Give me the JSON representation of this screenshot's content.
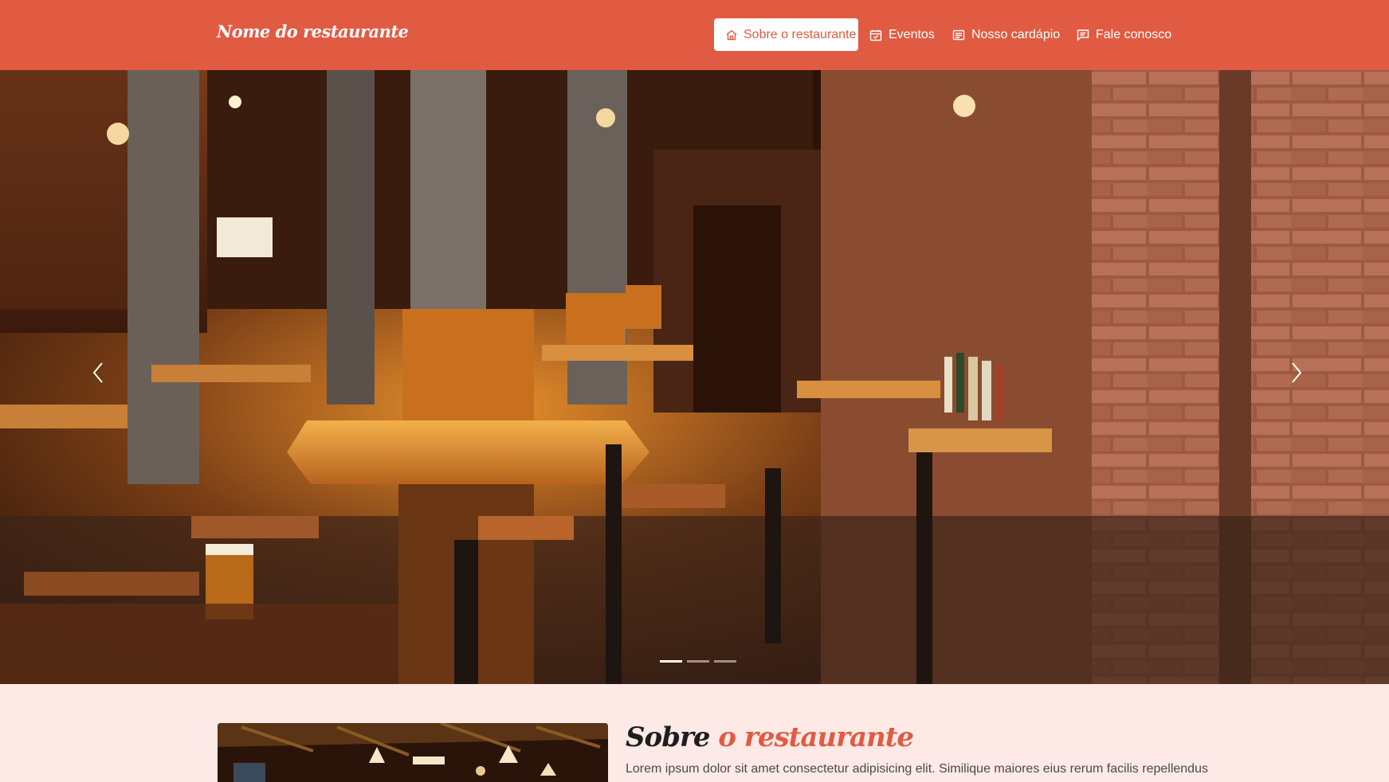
{
  "navbar": {
    "brand": "Nome do restaurante",
    "items": [
      {
        "label": "Sobre o restaurante",
        "icon": "home-icon",
        "active": true
      },
      {
        "label": "Eventos",
        "icon": "calendar-check-icon",
        "active": false
      },
      {
        "label": "Nosso cardápio",
        "icon": "menu-card-icon",
        "active": false
      },
      {
        "label": "Fale conosco",
        "icon": "chat-icon",
        "active": false
      }
    ]
  },
  "hero": {
    "slide_count": 3,
    "active_slide": 1
  },
  "about": {
    "title_part1": "Sobre",
    "title_part2": "o restaurante",
    "text": "Lorem ipsum dolor sit amet consectetur adipisicing elit. Similique maiores eius rerum facilis repellendus"
  },
  "colors": {
    "primary": "#e05b42",
    "section_bg": "#fde9e6",
    "white": "#ffffff"
  }
}
